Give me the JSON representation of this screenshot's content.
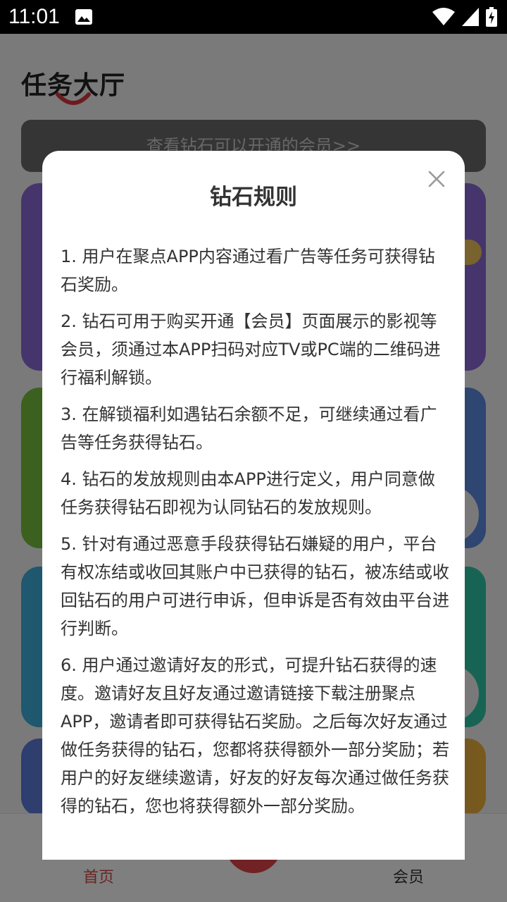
{
  "status_bar": {
    "time": "11:01"
  },
  "app": {
    "title": "任务大厅",
    "member_banner": "查看钻石可以开通的会员>>",
    "nav": {
      "home": "首页",
      "member": "会员"
    }
  },
  "dialog": {
    "title": "钻石规则",
    "rules": [
      "1. 用户在聚点APP内容通过看广告等任务可获得钻石奖励。",
      "2. 钻石可用于购买开通【会员】页面展示的影视等会员，须通过本APP扫码对应TV或PC端的二维码进行福利解锁。",
      "3. 在解锁福利如遇钻石余额不足，可继续通过看广告等任务获得钻石。",
      "4. 钻石的发放规则由本APP进行定义，用户同意做任务获得钻石即视为认同钻石的发放规则。",
      "5. 针对有通过恶意手段获得钻石嫌疑的用户，平台有权冻结或收回其账户中已获得的钻石，被冻结或收回钻石的用户可进行申诉，但申诉是否有效由平台进行判断。",
      "6. 用户通过邀请好友的形式，可提升钻石获得的速度。邀请好友且好友通过邀请链接下载注册聚点APP，邀请者即可获得钻石奖励。之后每次好友通过做任务获得的钻石，您都将获得额外一部分奖励；若用户的好友继续邀请，好友的好友每次通过做任务获得的钻石，您也将获得额外一部分奖励。"
    ]
  }
}
